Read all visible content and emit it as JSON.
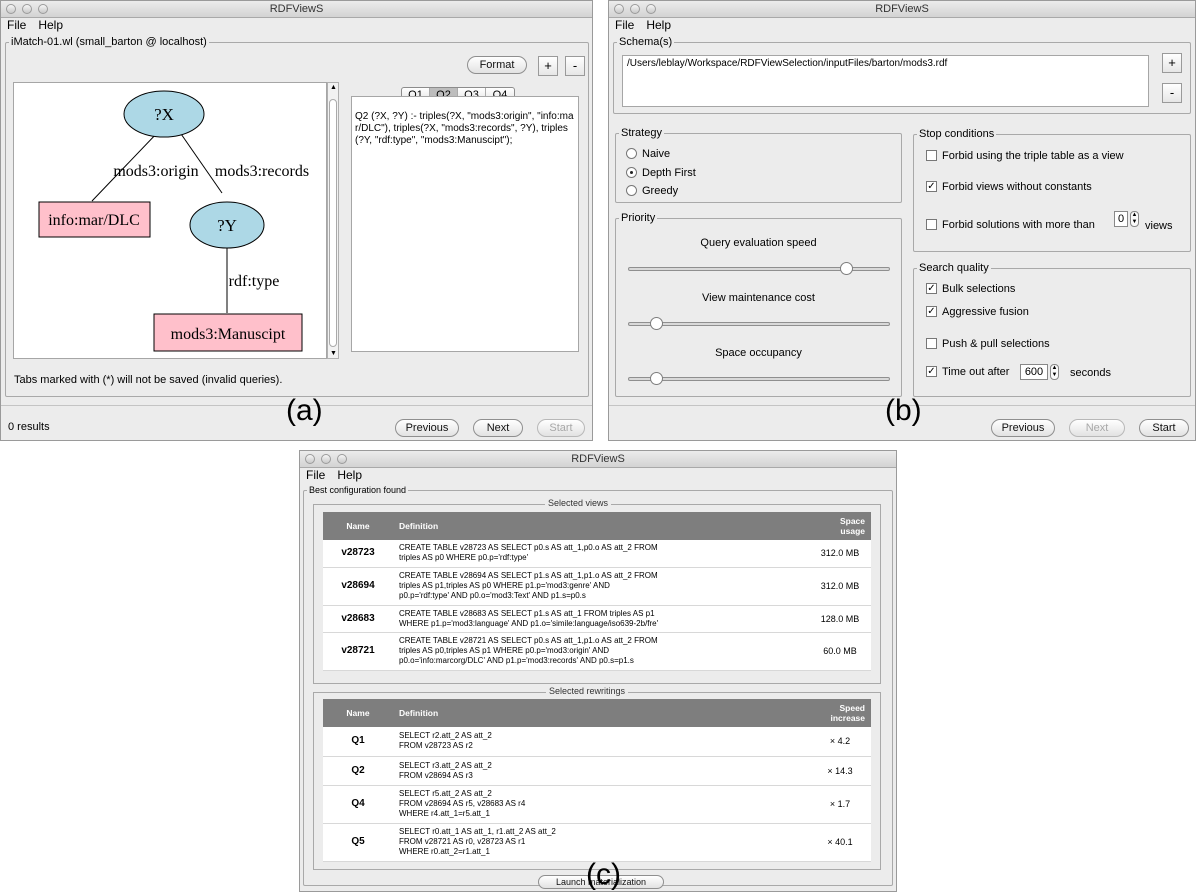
{
  "window_a": {
    "title": "RDFViewS",
    "menu": [
      "File",
      "Help"
    ],
    "group_label": "iMatch-01.wl (small_barton @ localhost)",
    "format_button": "Format",
    "plus": "+",
    "minus": "-",
    "graph": {
      "nodes": {
        "x": "?X",
        "y": "?Y",
        "dlc": "info:mar/DLC",
        "man": "mods3:Manuscipt"
      },
      "edges": {
        "origin": "mods3:origin",
        "records": "mods3:records",
        "type": "rdf:type"
      }
    },
    "tabs": [
      "Q1",
      "Q2",
      "Q3",
      "Q4"
    ],
    "active_tab": "Q2",
    "query_text": "Q2 (?X, ?Y) :- triples(?X, \"mods3:origin\", \"info:mar/DLC\"), triples(?X, \"mods3:records\", ?Y), triples(?Y, \"rdf:type\", \"mods3:Manuscipt\");",
    "note": "Tabs marked with (*) will not be saved (invalid queries).",
    "status": "0 results",
    "buttons": {
      "previous": "Previous",
      "next": "Next",
      "start": "Start"
    },
    "caption": "(a)"
  },
  "window_b": {
    "title": "RDFViewS",
    "menu": [
      "File",
      "Help"
    ],
    "schema_label": "Schema(s)",
    "schema_path": "/Users/leblay/Workspace/RDFViewSelection/inputFiles/barton/mods3.rdf",
    "plus": "+",
    "minus": "-",
    "strategy": {
      "label": "Strategy",
      "options": [
        "Naive",
        "Depth First",
        "Greedy"
      ],
      "selected": "Depth First"
    },
    "priority": {
      "label": "Priority",
      "sliders": [
        {
          "label": "Query evaluation speed",
          "level": 0.83
        },
        {
          "label": "View maintenance cost",
          "level": 0.1
        },
        {
          "label": "Space occupancy",
          "level": 0.1
        }
      ]
    },
    "stop": {
      "label": "Stop conditions",
      "forbid_triple": "Forbid using the triple table as a view",
      "forbid_constants": "Forbid views without constants",
      "forbid_solutions": "Forbid solutions with more than",
      "forbid_solutions_value": "0",
      "views_unit": "views"
    },
    "search": {
      "label": "Search quality",
      "bulk": "Bulk selections",
      "fusion": "Aggressive fusion",
      "push": "Push & pull selections",
      "timeout": "Time out after",
      "timeout_value": "600",
      "seconds": "seconds"
    },
    "buttons": {
      "previous": "Previous",
      "next": "Next",
      "start": "Start"
    },
    "caption": "(b)"
  },
  "window_c": {
    "title": "RDFViewS",
    "menu": [
      "File",
      "Help"
    ],
    "group_label": "Best configuration found",
    "views_title": "Selected views",
    "views_headers": [
      "Name",
      "Definition",
      "Space usage"
    ],
    "views": [
      {
        "name": "v28723",
        "def": [
          "CREATE TABLE v28723 AS SELECT p0.s AS att_1,p0.o AS att_2 FROM",
          "triples AS p0 WHERE p0.p='rdf:type'"
        ],
        "val": "312.0 MB"
      },
      {
        "name": "v28694",
        "def": [
          "CREATE TABLE v28694 AS SELECT p1.s AS att_1,p1.o AS att_2 FROM",
          "triples AS p1,triples AS p0 WHERE p1.p='mod3:genre' AND",
          "p0.p='rdf:type' AND p0.o='mod3:Text' AND p1.s=p0.s"
        ],
        "val": "312.0 MB"
      },
      {
        "name": "v28683",
        "def": [
          "CREATE TABLE v28683 AS SELECT p1.s AS att_1 FROM triples AS p1",
          "WHERE p1.p='mod3:language' AND p1.o='simile:language/iso639-2b/fre'"
        ],
        "val": "128.0 MB"
      },
      {
        "name": "v28721",
        "def": [
          "CREATE TABLE v28721 AS SELECT p0.s AS att_1,p1.o AS att_2 FROM",
          "triples AS p0,triples AS p1 WHERE p0.p='mod3:origin' AND",
          "p0.o='info:marcorg/DLC' AND p1.p='mod3:records' AND p0.s=p1.s"
        ],
        "val": "60.0 MB"
      }
    ],
    "rewrites_title": "Selected rewritings",
    "rewrites_headers": [
      "Name",
      "Definition",
      "Speed increase"
    ],
    "rewrites": [
      {
        "name": "Q1",
        "def": [
          "SELECT r2.att_2 AS att_2",
          "FROM v28723 AS r2"
        ],
        "val": "× 4.2"
      },
      {
        "name": "Q2",
        "def": [
          "SELECT r3.att_2 AS att_2",
          "FROM v28694 AS r3"
        ],
        "val": "× 14.3"
      },
      {
        "name": "Q4",
        "def": [
          "SELECT r5.att_2 AS att_2",
          "FROM v28694 AS r5, v28683 AS r4",
          "WHERE r4.att_1=r5.att_1"
        ],
        "val": "× 1.7"
      },
      {
        "name": "Q5",
        "def": [
          "SELECT r0.att_1 AS att_1, r1.att_2 AS att_2",
          "FROM v28721 AS r0, v28723 AS r1",
          "WHERE r0.att_2=r1.att_1"
        ],
        "val": "× 40.1"
      }
    ],
    "launch_button": "Launch materialization",
    "caption": "(c)"
  }
}
